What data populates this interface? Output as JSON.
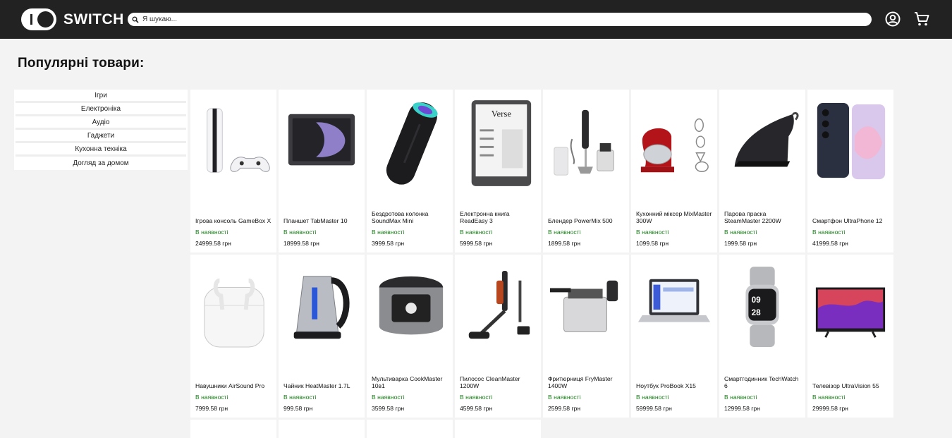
{
  "header": {
    "logo_text": "SWITCH",
    "search_placeholder": "Я шукаю...",
    "icons": [
      "user-icon",
      "cart-icon"
    ]
  },
  "page_title": "Популярні товари:",
  "categories": [
    "Ігри",
    "Електроніка",
    "Аудіо",
    "Гаджети",
    "Кухонна техніка",
    "Догляд за домом"
  ],
  "products": [
    {
      "name": "Ігрова консоль GameBox X",
      "stock": "В наявності",
      "price": "24999.58 грн",
      "icon": "game-console"
    },
    {
      "name": "Планшет TabMaster 10",
      "stock": "В наявності",
      "price": "18999.58 грн",
      "icon": "tablet"
    },
    {
      "name": "Бездротова колонка SoundMax Mini",
      "stock": "В наявності",
      "price": "3999.58 грн",
      "icon": "speaker"
    },
    {
      "name": "Електронна книга ReadEasy 3",
      "stock": "В наявності",
      "price": "5999.58 грн",
      "icon": "ebook"
    },
    {
      "name": "Блендер PowerMix 500",
      "stock": "В наявності",
      "price": "1899.58 грн",
      "icon": "blender"
    },
    {
      "name": "Кухонний міксер MixMaster 300W",
      "stock": "В наявності",
      "price": "1099.58 грн",
      "icon": "mixer"
    },
    {
      "name": "Парова праска SteamMaster 2200W",
      "stock": "В наявності",
      "price": "1999.58 грн",
      "icon": "iron"
    },
    {
      "name": "Смартфон UltraPhone 12",
      "stock": "В наявності",
      "price": "41999.58 грн",
      "icon": "smartphone"
    },
    {
      "name": "Навушники AirSound Pro",
      "stock": "В наявності",
      "price": "7999.58 грн",
      "icon": "earbuds"
    },
    {
      "name": "Чайник HeatMaster 1.7L",
      "stock": "В наявності",
      "price": "999.58 грн",
      "icon": "kettle"
    },
    {
      "name": "Мультиварка CookMaster 10в1",
      "stock": "В наявності",
      "price": "3599.58 грн",
      "icon": "multicooker"
    },
    {
      "name": "Пилосос CleanMaster 1200W",
      "stock": "В наявності",
      "price": "4599.58 грн",
      "icon": "vacuum"
    },
    {
      "name": "Фритюрниця FryMaster 1400W",
      "stock": "В наявності",
      "price": "2599.58 грн",
      "icon": "fryer"
    },
    {
      "name": "Ноутбук ProBook X15",
      "stock": "В наявності",
      "price": "59999.58 грн",
      "icon": "laptop"
    },
    {
      "name": "Смартгодинник TechWatch 6",
      "stock": "В наявності",
      "price": "12999.58 грн",
      "icon": "smartwatch"
    },
    {
      "name": "Телевізор UltraVision 55",
      "stock": "В наявності",
      "price": "29999.58 грн",
      "icon": "tv"
    }
  ],
  "partial_cards": 4,
  "colors": {
    "header_bg": "#222222",
    "stock_green": "#1a7f1a",
    "page_bg": "#f3f3f3"
  }
}
